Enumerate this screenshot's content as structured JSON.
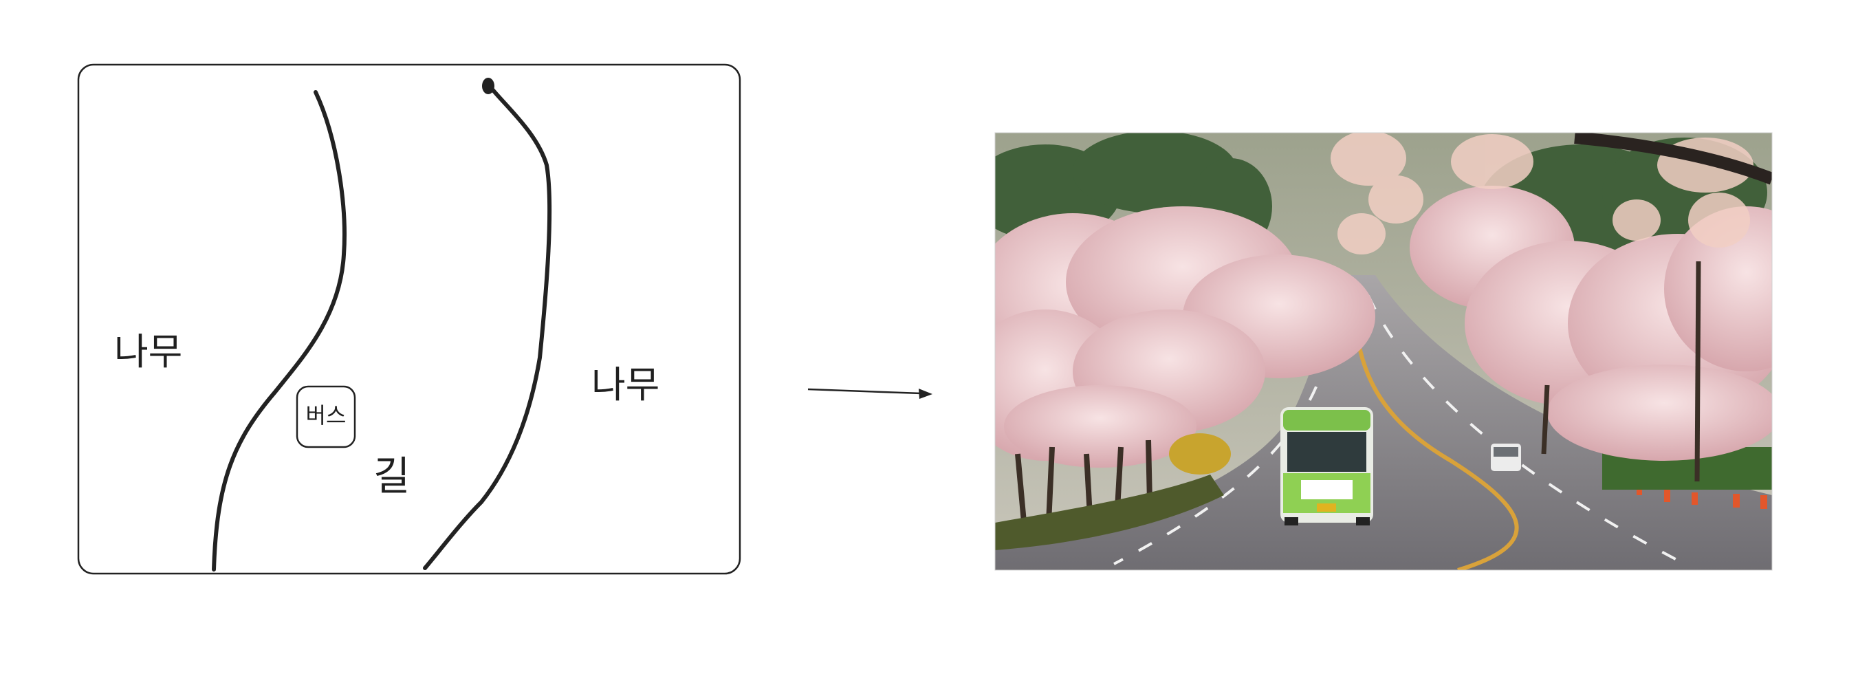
{
  "sketch": {
    "label_tree_left": "나무",
    "label_tree_right": "나무",
    "label_bus": "버스",
    "label_road": "길"
  },
  "photo": {
    "subject": "cherry-blossom-road-with-bus",
    "colors": {
      "blossom": "#e9c4c4",
      "road": "#8f8c91",
      "bus_body": "#7cc04b",
      "sky_haze": "#b9b7a9"
    }
  }
}
